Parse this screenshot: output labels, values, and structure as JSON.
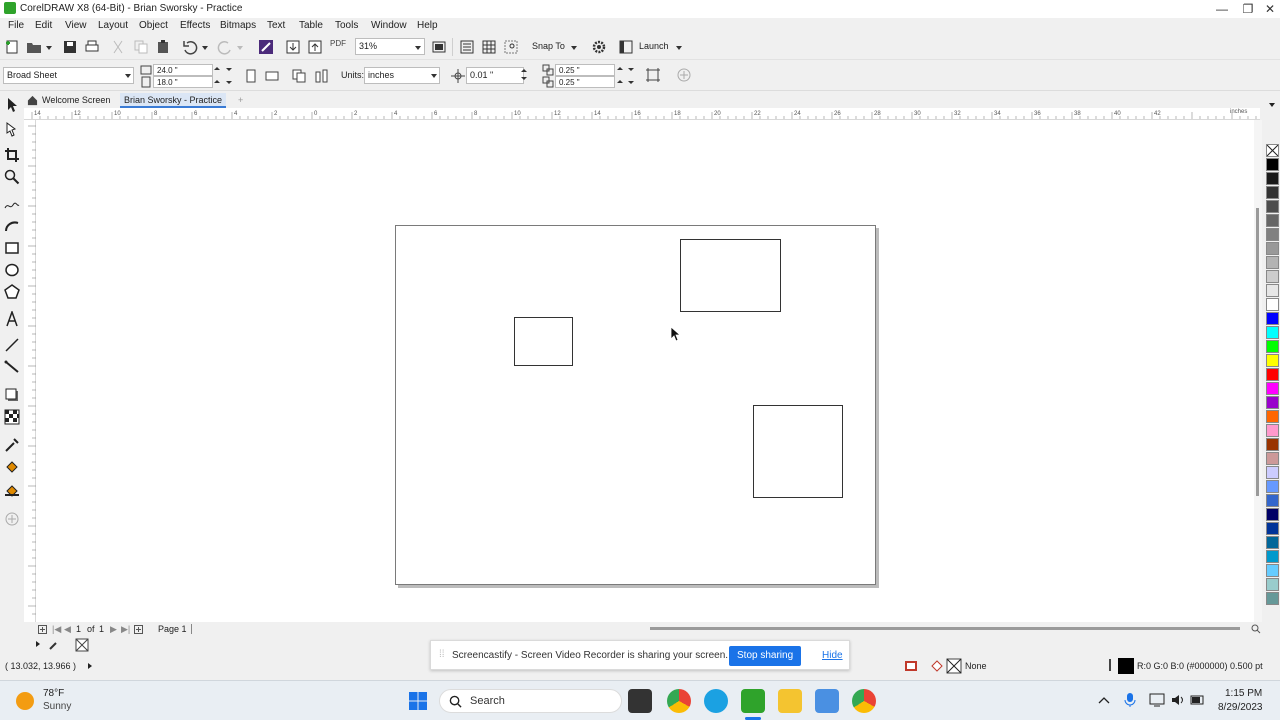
{
  "window": {
    "title": "CorelDRAW X8 (64-Bit) - Brian Sworsky - Practice",
    "minimize": "—",
    "maximize": "❐",
    "close": "✕"
  },
  "menu": [
    {
      "label": "File"
    },
    {
      "label": "Edit"
    },
    {
      "label": "View"
    },
    {
      "label": "Layout"
    },
    {
      "label": "Object"
    },
    {
      "label": "Effects"
    },
    {
      "label": "Bitmaps"
    },
    {
      "label": "Text"
    },
    {
      "label": "Table"
    },
    {
      "label": "Tools"
    },
    {
      "label": "Window"
    },
    {
      "label": "Help"
    }
  ],
  "toolbar": {
    "zoom_value": "31%",
    "pdf_label": "PDF",
    "snap_to": "Snap To",
    "launch": "Launch"
  },
  "propertybar": {
    "page_size": "Broad Sheet",
    "width": "24.0 \"",
    "height": "18.0 \"",
    "units_label": "Units:",
    "units_value": "inches",
    "nudge": "0.01 \"",
    "dup_x": "0.25 \"",
    "dup_y": "0.25 \""
  },
  "tabs": {
    "welcome": "Welcome Screen",
    "document": "Brian Sworsky - Practice",
    "add": "+"
  },
  "ruler": {
    "units": "inches",
    "top_labels": [
      "14",
      "12",
      "10",
      "8",
      "6",
      "4",
      "2",
      "0",
      "2",
      "4",
      "6",
      "8",
      "10",
      "12",
      "14",
      "16",
      "18",
      "20",
      "22",
      "24",
      "26",
      "28",
      "30",
      "32",
      "34",
      "36",
      "38",
      "40",
      "42"
    ]
  },
  "pagenav": {
    "current": "1",
    "of": "of",
    "total": "1",
    "page_tab": "Page 1"
  },
  "status": {
    "coordinates": "( 13.032, 13.966 )",
    "fill": "None",
    "outline": "R:0 G:0 B:0 (#000000)  0.500 pt"
  },
  "notification": {
    "message": "Screencastify - Screen Video Recorder is sharing your screen.",
    "stop": "Stop sharing",
    "hide": "Hide"
  },
  "taskbar": {
    "weather_temp": "78°F",
    "weather_desc": "Sunny",
    "search": "Search",
    "time": "1:15 PM",
    "date": "8/29/2023"
  },
  "palette_colors": [
    "#000000",
    "#1a1a1a",
    "#333333",
    "#4d4d4d",
    "#666666",
    "#808080",
    "#999999",
    "#b3b3b3",
    "#cccccc",
    "#e6e6e6",
    "#ffffff",
    "#0000ff",
    "#00ffff",
    "#00ff00",
    "#ffff00",
    "#ff0000",
    "#ff00ff",
    "#9900cc",
    "#ff6600",
    "#ff99cc",
    "#993300",
    "#cc9999",
    "#ccccff",
    "#6699ff",
    "#3366cc",
    "#000066",
    "#003399",
    "#006699",
    "#0099cc",
    "#66ccff",
    "#99cccc",
    "#669999"
  ],
  "colors": {
    "accent": "#1a73e8",
    "coreldraw_green": "#2fa32b"
  }
}
